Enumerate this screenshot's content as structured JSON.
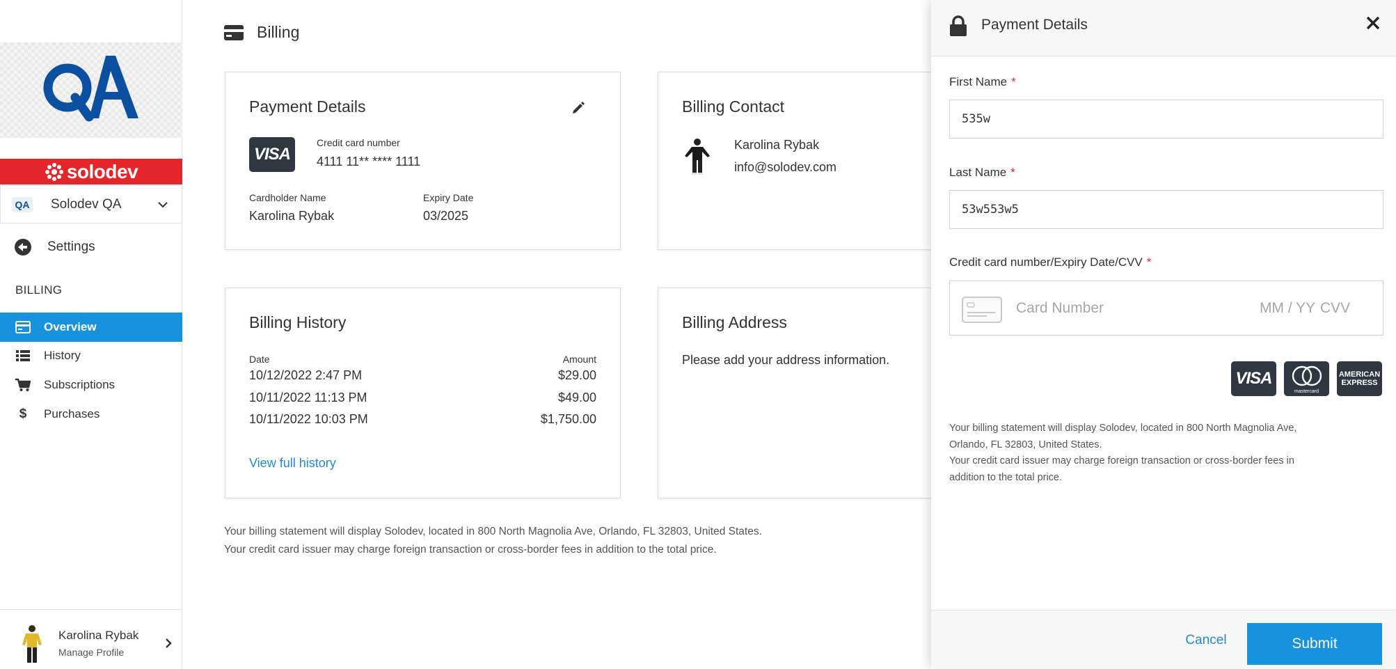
{
  "sidebar": {
    "brand_name": "solodev",
    "logo_text": "QA",
    "org": {
      "badge": "QA",
      "name": "Solodev QA"
    },
    "settings_label": "Settings",
    "section_label": "BILLING",
    "items": [
      {
        "label": "Overview",
        "icon": "card-icon",
        "active": true
      },
      {
        "label": "History",
        "icon": "list-icon",
        "active": false
      },
      {
        "label": "Subscriptions",
        "icon": "cart-icon",
        "active": false
      },
      {
        "label": "Purchases",
        "icon": "dollar-icon",
        "active": false
      }
    ],
    "profile": {
      "name": "Karolina Rybak",
      "subtitle": "Manage Profile"
    }
  },
  "main": {
    "page_title": "Billing",
    "payment_card": {
      "title": "Payment Details",
      "card_brand": "VISA",
      "cc_label": "Credit card number",
      "cc_value": "4111 11** **** 1111",
      "holder_label": "Cardholder Name",
      "holder_value": "Karolina Rybak",
      "expiry_label": "Expiry Date",
      "expiry_value": "03/2025"
    },
    "contact_card": {
      "title": "Billing Contact",
      "name": "Karolina Rybak",
      "email": "info@solodev.com"
    },
    "history_card": {
      "title": "Billing History",
      "col_date": "Date",
      "col_amount": "Amount",
      "rows": [
        {
          "date": "10/12/2022 2:47 PM",
          "amount": "$29.00"
        },
        {
          "date": "10/11/2022 11:13 PM",
          "amount": "$49.00"
        },
        {
          "date": "10/11/2022 10:03 PM",
          "amount": "$1,750.00"
        }
      ],
      "link": "View full history"
    },
    "address_card": {
      "title": "Billing Address",
      "message": "Please add your address information."
    },
    "footnote_line1": "Your billing statement will display Solodev, located in 800 North Magnolia Ave, Orlando, FL 32803, United States.",
    "footnote_line2": "Your credit card issuer may charge foreign transaction or cross-border fees in addition to the total price."
  },
  "drawer": {
    "title": "Payment Details",
    "first_name_label": "First Name",
    "first_name_value": "535w",
    "last_name_label": "Last Name",
    "last_name_value": "53w553w5",
    "cc_label": "Credit card number/Expiry Date/CVV",
    "required_mark": "*",
    "cc_number_placeholder": "Card Number",
    "cc_expiry_placeholder": "MM / YY",
    "cc_cvv_placeholder": "CVV",
    "card_brands": [
      "VISA",
      "mastercard",
      "AMERICAN EXPRESS"
    ],
    "note_line1": "Your billing statement will display Solodev, located in 800 North Magnolia Ave,",
    "note_line2": "Orlando, FL 32803, United States.",
    "note_line3": "Your credit card issuer may charge foreign transaction or cross-border fees in",
    "note_line4": "addition to the total price.",
    "cancel_label": "Cancel",
    "submit_label": "Submit"
  },
  "colors": {
    "accent": "#1692de",
    "brand_red": "#e4262b",
    "logo_blue": "#0b4fa0",
    "link": "#1f8ad6",
    "dark_card": "#303740"
  }
}
